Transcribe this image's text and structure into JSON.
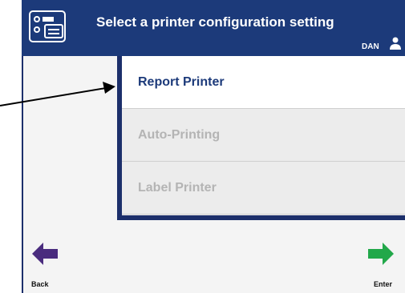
{
  "header": {
    "title": "Select a printer configuration setting",
    "user": "DAN",
    "bg_color": "#1c3a7a"
  },
  "list": {
    "items": [
      {
        "label": "Report Printer",
        "state": "active"
      },
      {
        "label": "Auto-Printing",
        "state": "disabled"
      },
      {
        "label": "Label Printer",
        "state": "disabled"
      }
    ]
  },
  "footer": {
    "back_label": "Back",
    "enter_label": "Enter",
    "back_color": "#4a2c7e",
    "enter_color": "#22a84a"
  },
  "icons": {
    "header": "printer-configuration-icon",
    "user": "user-icon",
    "back": "arrow-left-icon",
    "enter": "arrow-right-icon",
    "pointer": "pointer-arrow-icon"
  }
}
